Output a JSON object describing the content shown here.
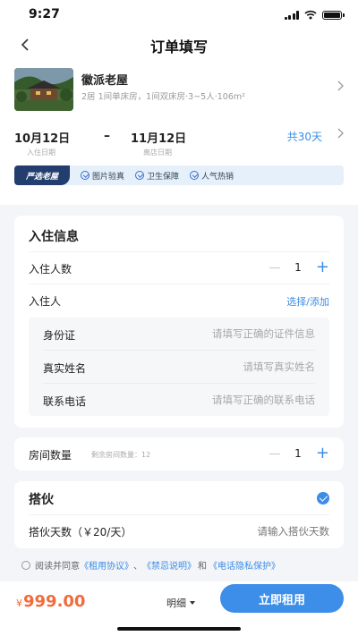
{
  "status": {
    "time": "9:27"
  },
  "nav": {
    "title": "订单填写"
  },
  "house": {
    "name": "徽派老屋",
    "desc": "2居  1间单床房，1间双床房·3~5人·106m²"
  },
  "dates": {
    "checkin_value": "10月12日",
    "checkin_label": "入住日期",
    "dash": "–",
    "checkout_value": "11月12日",
    "checkout_label": "离店日期",
    "nights": "共30天"
  },
  "badges": {
    "brand": "严选老屋",
    "items": [
      "图片验真",
      "卫生保障",
      "人气热销"
    ]
  },
  "checkin_info": {
    "title": "入住信息",
    "guests_label": "入住人数",
    "guests_count": "1",
    "occupant_label": "入住人",
    "occupant_action": "选择/添加",
    "fields": [
      {
        "label": "身份证",
        "placeholder": "请填写正确的证件信息"
      },
      {
        "label": "真实姓名",
        "placeholder": "请填写真实姓名"
      },
      {
        "label": "联系电话",
        "placeholder": "请填写正确的联系电话"
      }
    ]
  },
  "rooms": {
    "label": "房间数量",
    "remaining": "剩余房间数量：12",
    "count": "1"
  },
  "meals": {
    "title": "搭伙",
    "days_label": "搭伙天数（￥20/天）",
    "days_placeholder": "请输入搭伙天数"
  },
  "agreement": {
    "prefix": "阅读并同意",
    "link1": "《租用协议》",
    "sep1": "、",
    "link2": "《禁忌说明》",
    "sep2": "和",
    "link3": "《电话隐私保护》"
  },
  "footer": {
    "currency": "¥",
    "price": "999.00",
    "detail": "明细",
    "submit": "立即租用"
  },
  "colors": {
    "accent": "#3b8de6",
    "price": "#f26b3a",
    "brand_badge": "#223d6e"
  }
}
